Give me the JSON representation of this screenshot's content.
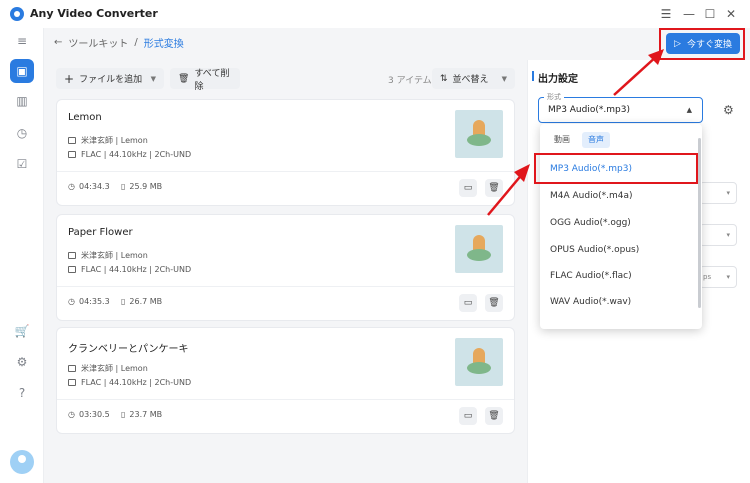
{
  "app": {
    "title": "Any Video Converter"
  },
  "window": {
    "menu": "☰",
    "minimize": "—",
    "maximize": "☐",
    "close": "✕"
  },
  "breadcrumb": {
    "back": "←",
    "parent": "ツールキット",
    "separator": "/",
    "current": "形式変換"
  },
  "toolbar": {
    "add_files": "ファイルを追加",
    "delete_all": "すべて削除",
    "item_count": "3 アイテム",
    "sort": "並べ替え"
  },
  "convert_button": "今すぐ変換",
  "files": [
    {
      "title": "Lemon",
      "artist": "米津玄師 | Lemon",
      "info": "FLAC | 44.10kHz | 2Ch-UND",
      "duration": "04:34.3",
      "size": "25.9 MB"
    },
    {
      "title": "Paper Flower",
      "artist": "米津玄師 | Lemon",
      "info": "FLAC | 44.10kHz | 2Ch-UND",
      "duration": "04:35.3",
      "size": "26.7 MB"
    },
    {
      "title": "クランベリーとパンケーキ",
      "artist": "米津玄師 | Lemon",
      "info": "FLAC | 44.10kHz | 2Ch-UND",
      "duration": "03:30.5",
      "size": "23.7 MB"
    }
  ],
  "output": {
    "title": "出力設定",
    "format_label": "形式",
    "format_value": "MP3 Audio(*.mp3)",
    "bg_text": "ps"
  },
  "dropdown": {
    "tabs": [
      "動画",
      "音声"
    ],
    "options": [
      "MP3 Audio(*.mp3)",
      "M4A Audio(*.m4a)",
      "OGG Audio(*.ogg)",
      "OPUS Audio(*.opus)",
      "FLAC Audio(*.flac)",
      "WAV Audio(*.wav)"
    ],
    "selected_index": 0
  },
  "colors": {
    "accent": "#2a7be0",
    "highlight": "#e0161c"
  }
}
